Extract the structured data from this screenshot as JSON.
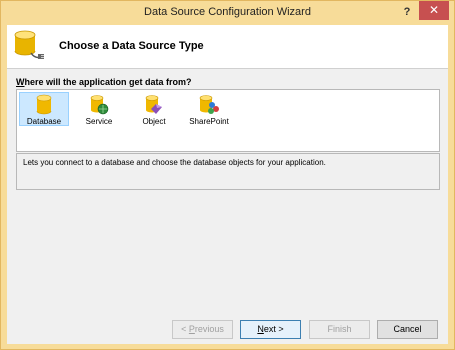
{
  "window": {
    "title": "Data Source Configuration Wizard",
    "help_label": "?",
    "close_label": "✕"
  },
  "header": {
    "title": "Choose a Data Source Type",
    "icon": "database-connector-icon"
  },
  "question": {
    "first_letter": "W",
    "rest": "here will the application get data from?"
  },
  "sources": [
    {
      "label": "Database",
      "icon": "database-icon",
      "selected": true
    },
    {
      "label": "Service",
      "icon": "service-icon",
      "selected": false
    },
    {
      "label": "Object",
      "icon": "object-icon",
      "selected": false
    },
    {
      "label": "SharePoint",
      "icon": "sharepoint-icon",
      "selected": false
    }
  ],
  "description": "Lets you connect to a database and choose the database objects for your application.",
  "buttons": {
    "previous": {
      "arrow": "< ",
      "mnemonic": "P",
      "rest": "revious",
      "enabled": false
    },
    "next": {
      "mnemonic": "N",
      "rest": "ext >",
      "enabled": true
    },
    "finish": {
      "label": "Finish",
      "enabled": false
    },
    "cancel": {
      "label": "Cancel",
      "enabled": true
    }
  },
  "colors": {
    "titlebar": "#f7dc99",
    "close_button": "#c75050",
    "selection": "#cce8ff",
    "database_yellow": "#f5c518"
  }
}
